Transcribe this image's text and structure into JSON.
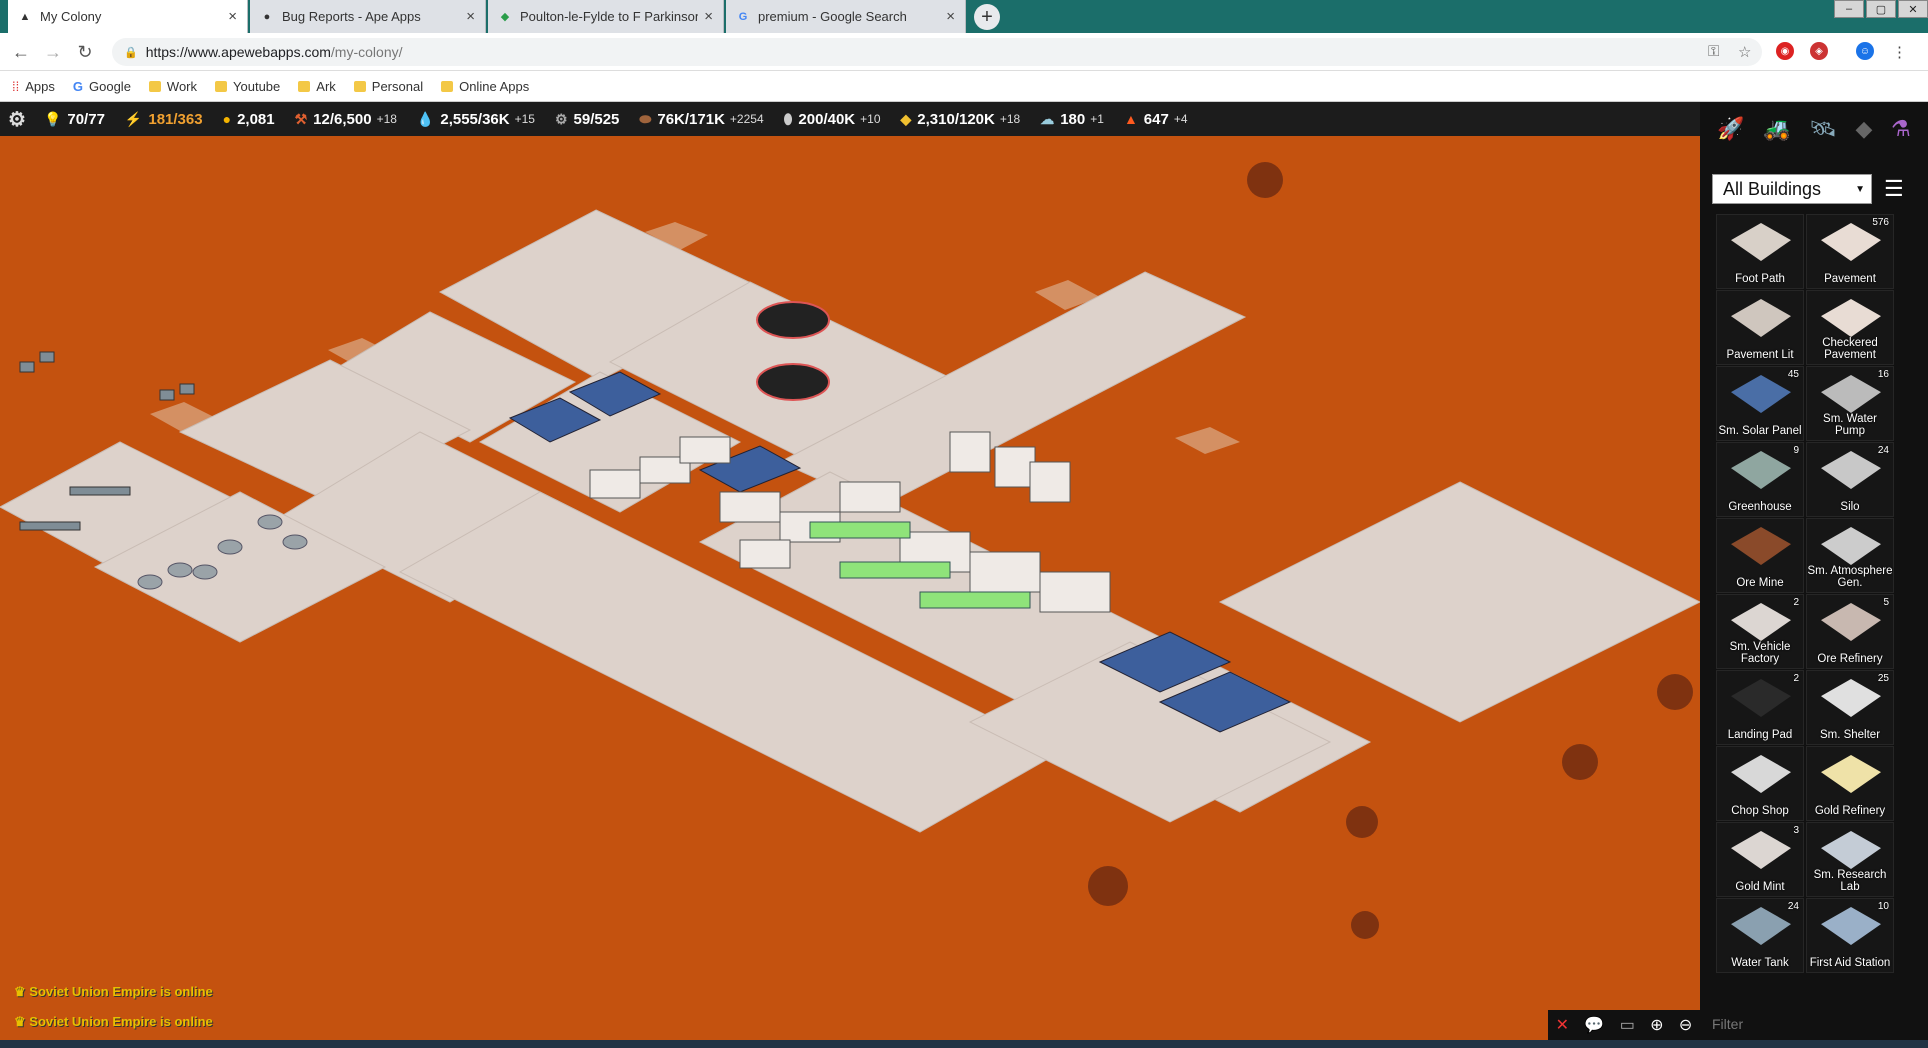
{
  "browser": {
    "tabs": [
      {
        "title": "My Colony",
        "active": true
      },
      {
        "title": "Bug Reports - Ape Apps",
        "active": false
      },
      {
        "title": "Poulton-le-Fylde to F Parkinson L",
        "active": false
      },
      {
        "title": "premium - Google Search",
        "active": false
      }
    ],
    "url_host": "https://www.apewebapps.com",
    "url_path": "/my-colony/",
    "bookmarks": [
      {
        "label": "Apps",
        "icon": "apps-grid-icon"
      },
      {
        "label": "Google",
        "icon": "google-icon"
      },
      {
        "label": "Work",
        "icon": "folder-icon"
      },
      {
        "label": "Youtube",
        "icon": "folder-icon"
      },
      {
        "label": "Ark",
        "icon": "folder-icon"
      },
      {
        "label": "Personal",
        "icon": "folder-icon"
      },
      {
        "label": "Online Apps",
        "icon": "folder-icon"
      }
    ]
  },
  "resources": [
    {
      "icon": "bulb-icon",
      "value": "70/77",
      "delta": "",
      "color": "#ffffff"
    },
    {
      "icon": "energy-icon",
      "value": "181/363",
      "delta": "",
      "color": "#f0a030"
    },
    {
      "icon": "coin-icon",
      "value": "2,081",
      "delta": "",
      "color": "#ffffff"
    },
    {
      "icon": "shovel-icon",
      "value": "12/6,500",
      "delta": "+18",
      "color": "#ffffff"
    },
    {
      "icon": "water-icon",
      "value": "2,555/36K",
      "delta": "+15",
      "color": "#ffffff"
    },
    {
      "icon": "gear-res-icon",
      "value": "59/525",
      "delta": "",
      "color": "#ffffff"
    },
    {
      "icon": "ore-icon",
      "value": "76K/171K",
      "delta": "+2254",
      "color": "#ffffff"
    },
    {
      "icon": "metal-icon",
      "value": "200/40K",
      "delta": "+10",
      "color": "#ffffff"
    },
    {
      "icon": "gold-icon",
      "value": "2,310/120K",
      "delta": "+18",
      "color": "#ffffff"
    },
    {
      "icon": "oxygen-icon",
      "value": "180",
      "delta": "+1",
      "color": "#ffffff"
    },
    {
      "icon": "fire-icon",
      "value": "647",
      "delta": "+4",
      "color": "#ffffff"
    }
  ],
  "sidebar": {
    "filter_selected": "All Buildings",
    "filter_placeholder": "Filter",
    "buildings": [
      {
        "label": "Foot Path",
        "count": ""
      },
      {
        "label": "Pavement",
        "count": "576"
      },
      {
        "label": "Pavement Lit",
        "count": ""
      },
      {
        "label": "Checkered Pavement",
        "count": ""
      },
      {
        "label": "Sm. Solar Panel",
        "count": "45"
      },
      {
        "label": "Sm. Water Pump",
        "count": "16"
      },
      {
        "label": "Greenhouse",
        "count": "9"
      },
      {
        "label": "Silo",
        "count": "24"
      },
      {
        "label": "Ore Mine",
        "count": ""
      },
      {
        "label": "Sm. Atmosphere Gen.",
        "count": ""
      },
      {
        "label": "Sm. Vehicle Factory",
        "count": "2"
      },
      {
        "label": "Ore Refinery",
        "count": "5"
      },
      {
        "label": "Landing Pad",
        "count": "2"
      },
      {
        "label": "Sm. Shelter",
        "count": "25"
      },
      {
        "label": "Chop Shop",
        "count": ""
      },
      {
        "label": "Gold Refinery",
        "count": ""
      },
      {
        "label": "Gold Mint",
        "count": "3"
      },
      {
        "label": "Sm. Research Lab",
        "count": ""
      },
      {
        "label": "Water Tank",
        "count": "24"
      },
      {
        "label": "First Aid Station",
        "count": "10"
      }
    ]
  },
  "chat": [
    "Soviet Union Empire is online",
    "Soviet Union Empire is online"
  ],
  "colors": {
    "ground": "#c4520f",
    "pavement": "#e0d6d0",
    "panel": "#111111"
  }
}
